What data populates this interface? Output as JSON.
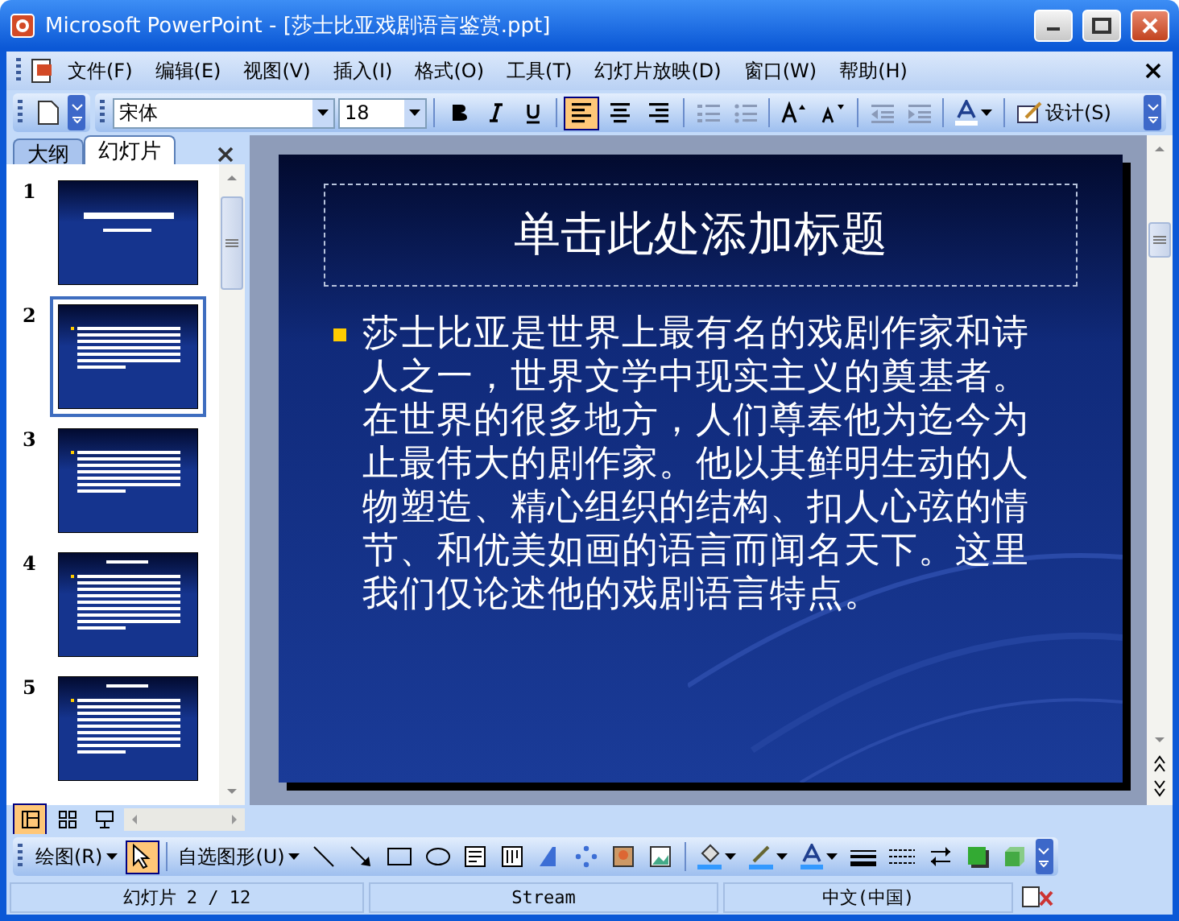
{
  "window": {
    "title": "Microsoft PowerPoint - [莎士比亚戏剧语言鉴赏.ppt]"
  },
  "menu": [
    "文件(F)",
    "编辑(E)",
    "视图(V)",
    "插入(I)",
    "格式(O)",
    "工具(T)",
    "幻灯片放映(D)",
    "窗口(W)",
    "帮助(H)"
  ],
  "format_toolbar": {
    "font": "宋体",
    "size": "18",
    "alignment": [
      {
        "kind": "left",
        "selected": true
      },
      {
        "kind": "center",
        "selected": false
      },
      {
        "kind": "right",
        "selected": false
      }
    ],
    "design_button": "设计(S)"
  },
  "tabs": [
    {
      "label": "大纲",
      "selected": false
    },
    {
      "label": "幻灯片",
      "selected": true
    }
  ],
  "thumbnails": [
    {
      "number": "1",
      "kind": "title",
      "selected": false
    },
    {
      "number": "2",
      "kind": "text",
      "selected": true
    },
    {
      "number": "3",
      "kind": "text",
      "selected": false
    },
    {
      "number": "4",
      "kind": "heading_text",
      "selected": false
    },
    {
      "number": "5",
      "kind": "heading_text",
      "selected": false
    }
  ],
  "slide": {
    "title_placeholder": "单击此处添加标题",
    "body": "莎士比亚是世界上最有名的戏剧作家和诗人之一，世界文学中现实主义的奠基者。在世界的很多地方，人们尊奉他为迄今为止最伟大的剧作家。他以其鲜明生动的人物塑造、精心组织的结构、扣人心弦的情节、和优美如画的语言而闻名天下。这里我们仅论述他的戏剧语言特点。"
  },
  "drawing_toolbar": {
    "draw_menu": "绘图(R)",
    "autoshapes_menu": "自选图形(U)",
    "select_tool_selected": true
  },
  "status_bar": [
    "幻灯片 2 / 12",
    "Stream",
    "中文(中国)"
  ]
}
